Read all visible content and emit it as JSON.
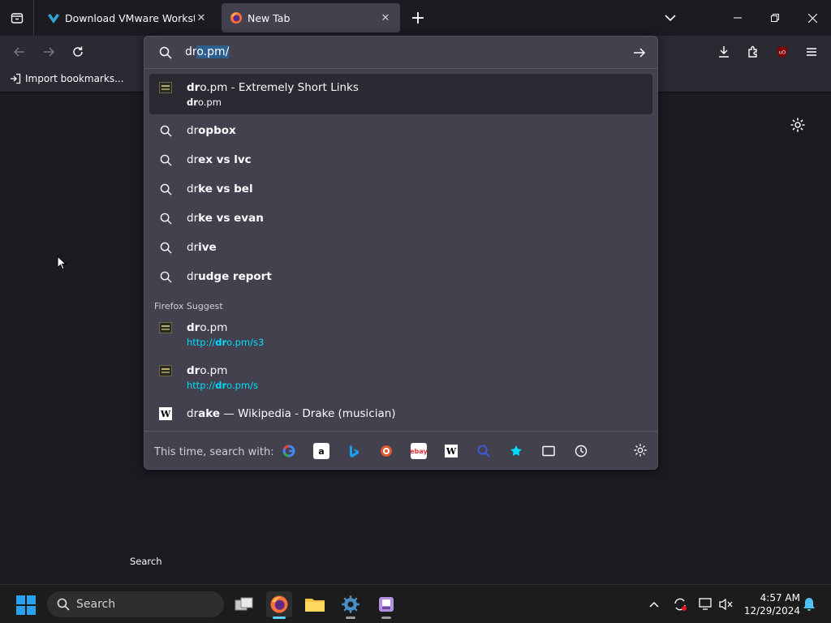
{
  "tabs": [
    {
      "title": "Download VMware Workstation",
      "active": false
    },
    {
      "title": "New Tab",
      "active": true
    }
  ],
  "bookmarks": {
    "import_label": "Import bookmarks..."
  },
  "urlbar": {
    "typed": "dr",
    "autofill": "o.pm/"
  },
  "results": [
    {
      "type": "site",
      "bold": "dr",
      "rest": "o.pm - Extremely Short Links",
      "sub_bold": "dr",
      "sub_rest": "o.pm",
      "selected": true
    },
    {
      "type": "search",
      "plain": "dr",
      "bold": "opbox"
    },
    {
      "type": "search",
      "plain": "dr",
      "bold": "ex vs lvc"
    },
    {
      "type": "search",
      "plain": "dr",
      "bold": "ke vs bel"
    },
    {
      "type": "search",
      "plain": "dr",
      "bold": "ke vs evan"
    },
    {
      "type": "search",
      "plain": "dr",
      "bold": "ive"
    },
    {
      "type": "search",
      "plain": "dr",
      "bold": "udge report"
    }
  ],
  "suggest_label": "Firefox Suggest",
  "suggest": [
    {
      "bold": "dr",
      "rest": "o.pm",
      "url_prefix": "http://",
      "url_bold": "dr",
      "url_rest": "o.pm/s3"
    },
    {
      "bold": "dr",
      "rest": "o.pm",
      "url_prefix": "http://",
      "url_bold": "dr",
      "url_rest": "o.pm/s"
    }
  ],
  "wiki": {
    "plain": "dr",
    "bold": "ake",
    "rest": " — Wikipedia - Drake (musician)"
  },
  "footer": {
    "label": "This time, search with:"
  },
  "content": {
    "search_label": "Search"
  },
  "taskbar": {
    "search_placeholder": "Search",
    "time": "4:57 AM",
    "date": "12/29/2024"
  }
}
